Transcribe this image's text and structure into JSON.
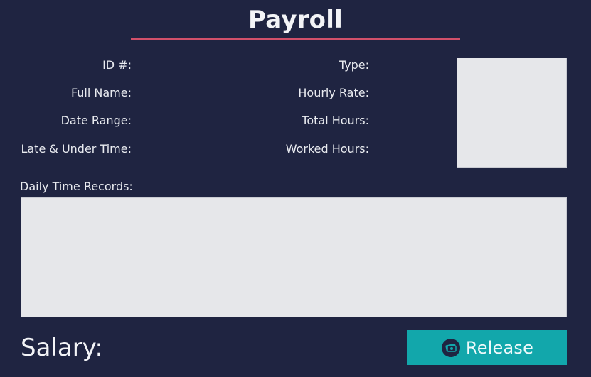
{
  "header": {
    "title": "Payroll",
    "accent_color": "#d1506a"
  },
  "form": {
    "left": [
      {
        "label": "ID #:"
      },
      {
        "label": "Full Name:"
      },
      {
        "label": "Date Range:"
      },
      {
        "label": "Late & Under Time:"
      }
    ],
    "right": [
      {
        "label": "Type:"
      },
      {
        "label": "Hourly Rate:"
      },
      {
        "label": "Total Hours:"
      },
      {
        "label": "Worked Hours:"
      }
    ]
  },
  "daily_time_records": {
    "label": "Daily Time Records:"
  },
  "footer": {
    "salary_label": "Salary:",
    "release_button_label": "Release",
    "release_icon": "payment-icon",
    "button_color": "#12a7ab"
  },
  "theme": {
    "background": "#1f2441",
    "panel": "#e6e7ea"
  }
}
